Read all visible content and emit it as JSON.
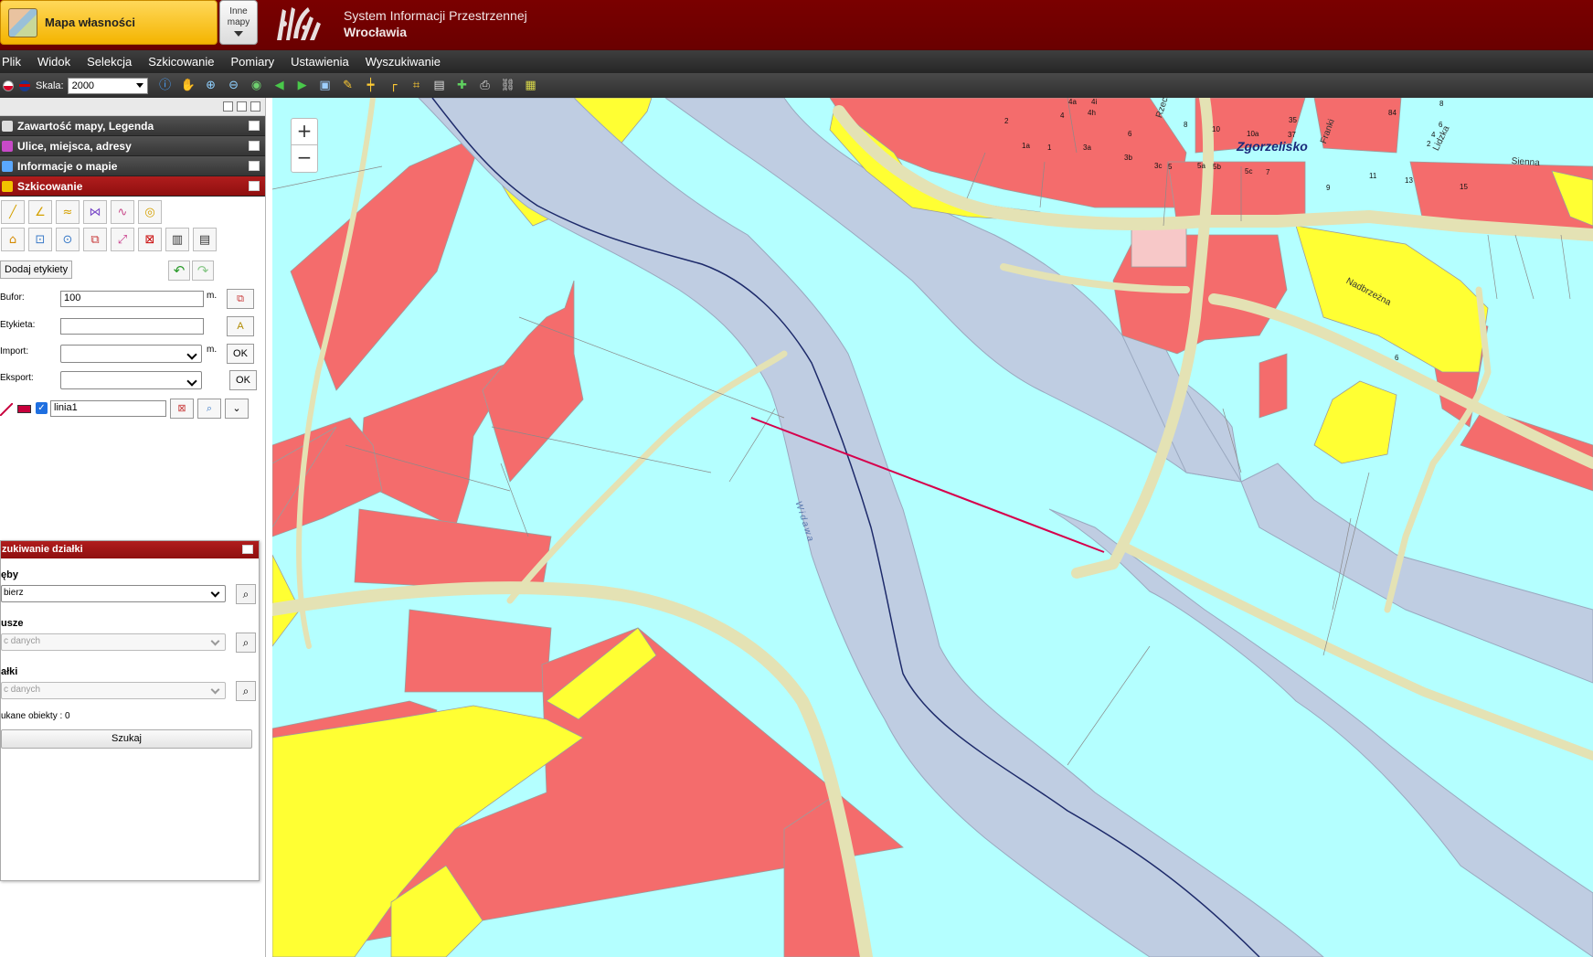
{
  "header": {
    "map_switch_label": "Mapa własności",
    "other_maps_line1": "Inne",
    "other_maps_line2": "mapy",
    "system_name_line1": "System Informacji Przestrzennej",
    "system_name_line2": "Wrocławia"
  },
  "menu": [
    "Plik",
    "Widok",
    "Selekcja",
    "Szkicowanie",
    "Pomiary",
    "Ustawienia",
    "Wyszukiwanie"
  ],
  "toolbar": {
    "scale_label": "Skala:",
    "scale_value": "2000",
    "icons": [
      "info-icon",
      "hand-pan-icon",
      "zoom-in-icon",
      "zoom-out-icon",
      "globe-icon",
      "arrow-left-icon",
      "arrow-right-icon",
      "zoom-extent-icon",
      "pencil-icon",
      "measure-line-icon",
      "measure-angle-icon",
      "crop-icon",
      "layers-icon",
      "wms-icon",
      "print-icon",
      "link-icon",
      "export-map-icon"
    ]
  },
  "left_panel": {
    "accordion": [
      {
        "label": "Zawartość mapy, Legenda",
        "active": false
      },
      {
        "label": "Ulice, miejsca, adresy",
        "active": false
      },
      {
        "label": "Informacje o mapie",
        "active": false
      },
      {
        "label": "Szkicowanie",
        "active": true
      }
    ],
    "sketch": {
      "tools_row1": [
        "draw-point-icon",
        "draw-line-icon",
        "draw-polyline-icon",
        "draw-polygon-icon",
        "draw-freehand-icon",
        "draw-circle-icon"
      ],
      "tools_row2": [
        "select-feature-icon",
        "zoom-to-sketch-icon",
        "center-icon",
        "copy-features-icon",
        "edit-vertices-icon",
        "delete-feature-icon",
        "layers-copy-icon",
        "properties-icon"
      ],
      "add_labels": "Dodaj etykiety",
      "buffer_label": "Bufor:",
      "buffer_value": "100",
      "buffer_unit": "m.",
      "label_label": "Etykieta:",
      "label_value": "",
      "import_label": "Import:",
      "import_unit": "m.",
      "import_ok": "OK",
      "export_label": "Eksport:",
      "export_ok": "OK",
      "line_name": "linia1",
      "line_visible": true,
      "line_color": "#c8003c"
    }
  },
  "search_panel": {
    "title": "zukiwanie działki",
    "section1_label": "ęby",
    "section1_value": "bierz",
    "section2_label": "usze",
    "section2_value": "c danych",
    "section3_label": "ałki",
    "section3_value": "c danych",
    "found_text": "ukane obiekty : 0",
    "search_button": "Szukaj"
  },
  "map": {
    "zoom_in": "+",
    "zoom_out": "−",
    "place_label": "Zgorzelisko",
    "river_label": "Widawa",
    "streets": [
      "Rzeczna",
      "Franki",
      "Lidzka",
      "Sienna",
      "Nadbrzeżna"
    ],
    "parcel_numbers": [
      "2",
      "4a",
      "4",
      "4h",
      "4i",
      "6",
      "8",
      "10",
      "10a",
      "35",
      "37",
      "84",
      "8",
      "6",
      "4",
      "2",
      "1a",
      "1",
      "3a",
      "3b",
      "3c",
      "5",
      "5a",
      "5b",
      "5c",
      "7",
      "9",
      "11",
      "13",
      "15",
      "6"
    ],
    "colors": {
      "water": "#bfcde2",
      "land": "#b4ffff",
      "red_parcel": "#f46c6c",
      "yellow_parcel": "#ffff33",
      "road": "#e4e2b4",
      "sketch_line": "#d6004c"
    }
  }
}
